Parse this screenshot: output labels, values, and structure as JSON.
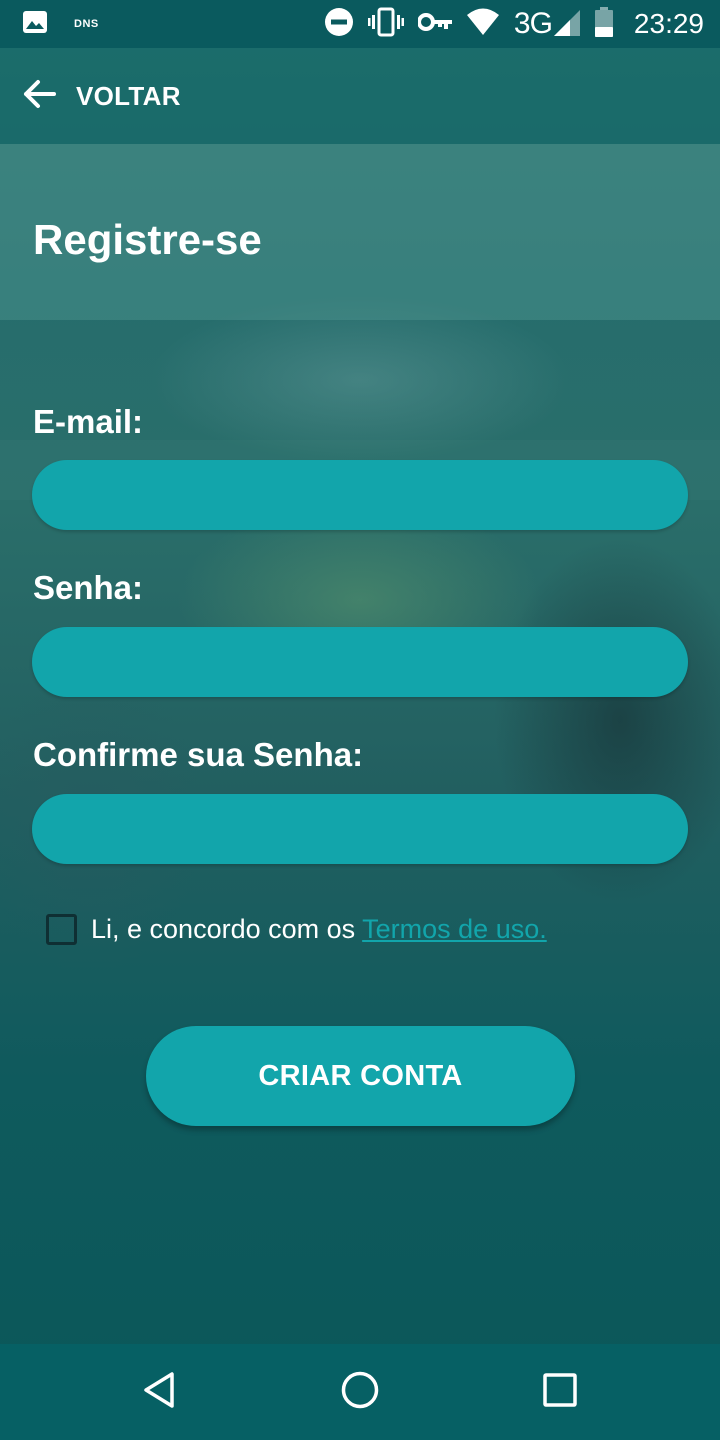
{
  "status_bar": {
    "dns_label": "DNS",
    "network": "3G",
    "time": "23:29",
    "icons": [
      "image-icon",
      "do-not-disturb-icon",
      "vibrate-icon",
      "vpn-key-icon",
      "wifi-icon",
      "signal-icon",
      "battery-icon"
    ]
  },
  "app_bar": {
    "back_icon": "arrow-left-icon",
    "back_label": "VOLTAR"
  },
  "header": {
    "title": "Registre-se"
  },
  "form": {
    "email": {
      "label": "E-mail:",
      "value": "",
      "placeholder": ""
    },
    "password": {
      "label": "Senha:",
      "value": "",
      "placeholder": ""
    },
    "confirm_password": {
      "label": "Confirme sua Senha:",
      "value": "",
      "placeholder": ""
    },
    "terms": {
      "checked": false,
      "text": "Li, e concordo com os",
      "link_text": "Termos de uso."
    },
    "submit_label": "CRIAR CONTA"
  },
  "nav_bar": {
    "icons": [
      "back-triangle-icon",
      "home-circle-icon",
      "recents-square-icon"
    ]
  },
  "colors": {
    "accent": "#12a5ab",
    "nav_bar": "#066064",
    "status_bar": "#0a5a5e"
  }
}
